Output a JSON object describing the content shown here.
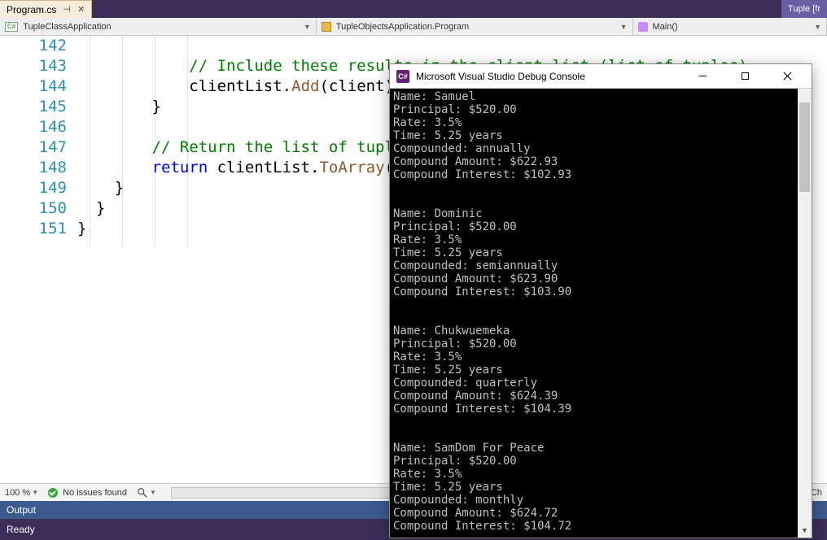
{
  "tab": {
    "filename": "Program.cs"
  },
  "right_chip": "Tuple [fr",
  "combos": {
    "project": "TupleClassApplication",
    "namespace": "TupleObjectsApplication.Program",
    "member": "Main()"
  },
  "code": {
    "lines": [
      "142",
      "143",
      "144",
      "145",
      "146",
      "147",
      "148",
      "149",
      "150",
      "151"
    ],
    "l142": "// Include these results in the client list (list of tuples)",
    "l143a": "clientList.",
    "l143b": "Add",
    "l143c": "(client);",
    "l144": "}",
    "l146": "// Return the list of tuples",
    "l147a": "return",
    "l147b": " clientList.",
    "l147c": "ToArray",
    "l147d": "();",
    "l148": "}",
    "l149": "}",
    "l150": "}"
  },
  "status": {
    "zoom": "100 %",
    "issues": "No issues found",
    "ch_label": "Ch"
  },
  "panels": {
    "output": "Output",
    "ready": "Ready"
  },
  "console": {
    "title": "Microsoft Visual Studio Debug Console",
    "records": [
      {
        "name": "Samuel",
        "principal": "$520.00",
        "rate": "3.5%",
        "time": "5.25 years",
        "compounded": "annually",
        "amount": "$622.93",
        "interest": "$102.93"
      },
      {
        "name": "Dominic",
        "principal": "$520.00",
        "rate": "3.5%",
        "time": "5.25 years",
        "compounded": "semiannually",
        "amount": "$623.90",
        "interest": "$103.90"
      },
      {
        "name": "Chukwuemeka",
        "principal": "$520.00",
        "rate": "3.5%",
        "time": "5.25 years",
        "compounded": "quarterly",
        "amount": "$624.39",
        "interest": "$104.39"
      },
      {
        "name": "SamDom For Peace",
        "principal": "$520.00",
        "rate": "3.5%",
        "time": "5.25 years",
        "compounded": "monthly",
        "amount": "$624.72",
        "interest": "$104.72"
      }
    ],
    "labels": {
      "name": "Name: ",
      "principal": "Principal: ",
      "rate": "Rate: ",
      "time": "Time: ",
      "compounded": "Compounded: ",
      "amount": "Compound Amount: ",
      "interest": "Compound Interest: "
    }
  }
}
